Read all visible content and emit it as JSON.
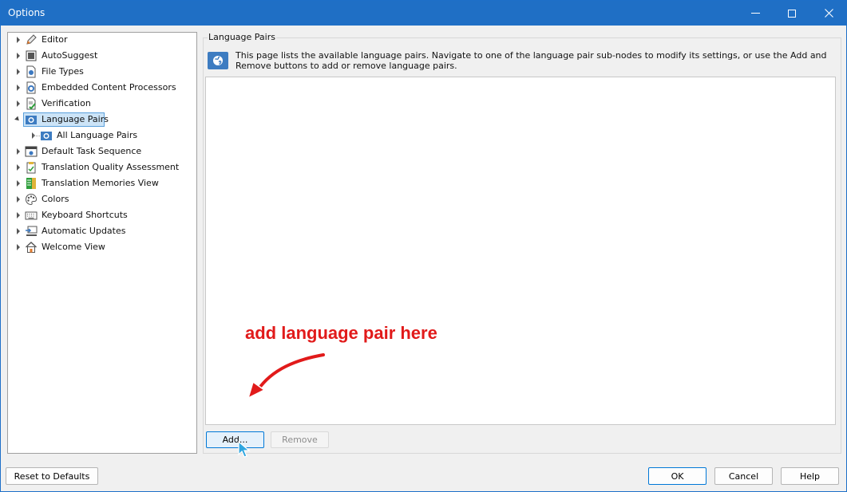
{
  "window": {
    "title": "Options",
    "controls": {
      "minimize": "minimize",
      "maximize": "maximize",
      "close": "close"
    }
  },
  "tree": {
    "items": [
      {
        "label": "Editor",
        "icon": "pencil-icon"
      },
      {
        "label": "AutoSuggest",
        "icon": "autosuggest-icon"
      },
      {
        "label": "File Types",
        "icon": "file-types-icon"
      },
      {
        "label": "Embedded Content Processors",
        "icon": "embedded-content-icon"
      },
      {
        "label": "Verification",
        "icon": "verification-icon"
      },
      {
        "label": "Language Pairs",
        "icon": "language-pairs-icon",
        "selected": true,
        "expanded": true
      },
      {
        "label": "All Language Pairs",
        "icon": "all-language-pairs-icon",
        "child": true
      },
      {
        "label": "Default Task Sequence",
        "icon": "task-sequence-icon"
      },
      {
        "label": "Translation Quality Assessment",
        "icon": "quality-assessment-icon"
      },
      {
        "label": "Translation Memories View",
        "icon": "translation-memories-icon"
      },
      {
        "label": "Colors",
        "icon": "palette-icon"
      },
      {
        "label": "Keyboard Shortcuts",
        "icon": "keyboard-icon"
      },
      {
        "label": "Automatic Updates",
        "icon": "updates-icon"
      },
      {
        "label": "Welcome View",
        "icon": "home-icon"
      }
    ]
  },
  "panel": {
    "group_title": "Language Pairs",
    "info_text": "This page lists the available language pairs. Navigate to one of the language pair sub-nodes to modify its settings, or use the Add and Remove buttons to add or remove language pairs.",
    "add_label": "Add...",
    "remove_label": "Remove"
  },
  "footer": {
    "reset_label": "Reset to Defaults",
    "ok_label": "OK",
    "cancel_label": "Cancel",
    "help_label": "Help"
  },
  "annotation": {
    "text": "add language pair here"
  },
  "colors": {
    "titlebar": "#1f6fc5",
    "selection": "#cce4f7",
    "annotation": "#e11a1a"
  }
}
